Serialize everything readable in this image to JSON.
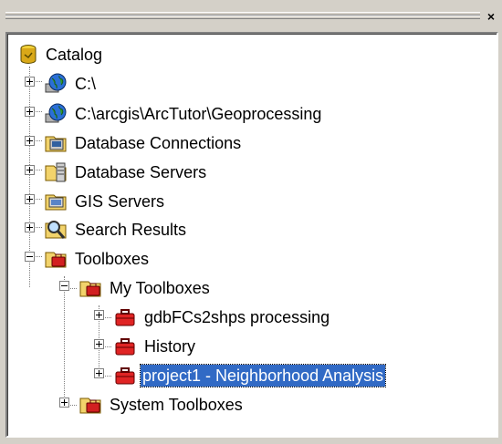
{
  "window": {
    "close_glyph": "×"
  },
  "tree": {
    "root_label": "Catalog",
    "items": [
      {
        "label": "C:\\",
        "icon": "globe-drive-icon"
      },
      {
        "label": "C:\\arcgis\\ArcTutor\\Geoprocessing",
        "icon": "globe-drive-icon"
      },
      {
        "label": "Database Connections",
        "icon": "database-connections-icon"
      },
      {
        "label": "Database Servers",
        "icon": "database-servers-icon"
      },
      {
        "label": "GIS Servers",
        "icon": "gis-servers-icon"
      },
      {
        "label": "Search Results",
        "icon": "search-results-icon"
      },
      {
        "label": "Toolboxes",
        "icon": "toolboxes-folder-icon"
      }
    ],
    "my_toolboxes": {
      "label": "My Toolboxes",
      "children": [
        {
          "label": "gdbFCs2shps processing"
        },
        {
          "label": "History"
        },
        {
          "label": "project1 - Neighborhood Analysis",
          "selected": true
        }
      ]
    },
    "system_toolboxes_label": "System Toolboxes"
  },
  "colors": {
    "selection": "#316ac5",
    "panel_bg": "#d4d0c8"
  }
}
